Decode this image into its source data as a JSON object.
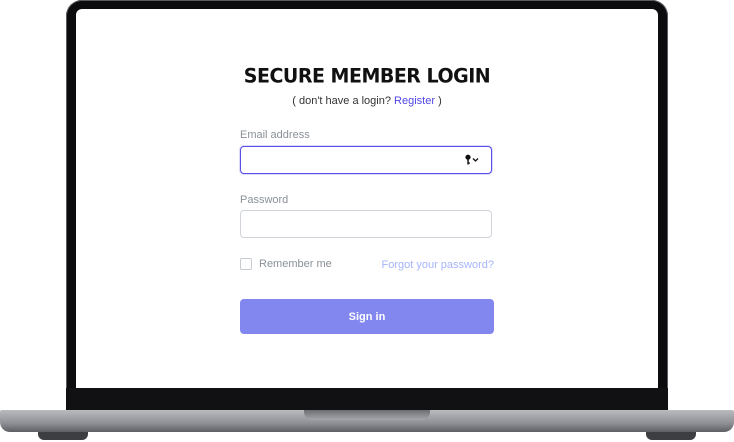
{
  "login": {
    "title": "SECURE MEMBER LOGIN",
    "subtitle_prefix": "( don't have a login?",
    "register_link": "Register",
    "subtitle_suffix": ")",
    "email": {
      "label": "Email address",
      "value": "",
      "placeholder": "",
      "icon": "key-icon"
    },
    "password": {
      "label": "Password",
      "value": "",
      "placeholder": ""
    },
    "remember_label": "Remember me",
    "remember_checked": false,
    "forgot_link": "Forgot your password?",
    "signin_label": "Sign in"
  },
  "colors": {
    "accent": "#5b50e6",
    "link": "#4f46e5",
    "forgot_link": "#a5b4fc",
    "button": "#8187ee"
  }
}
